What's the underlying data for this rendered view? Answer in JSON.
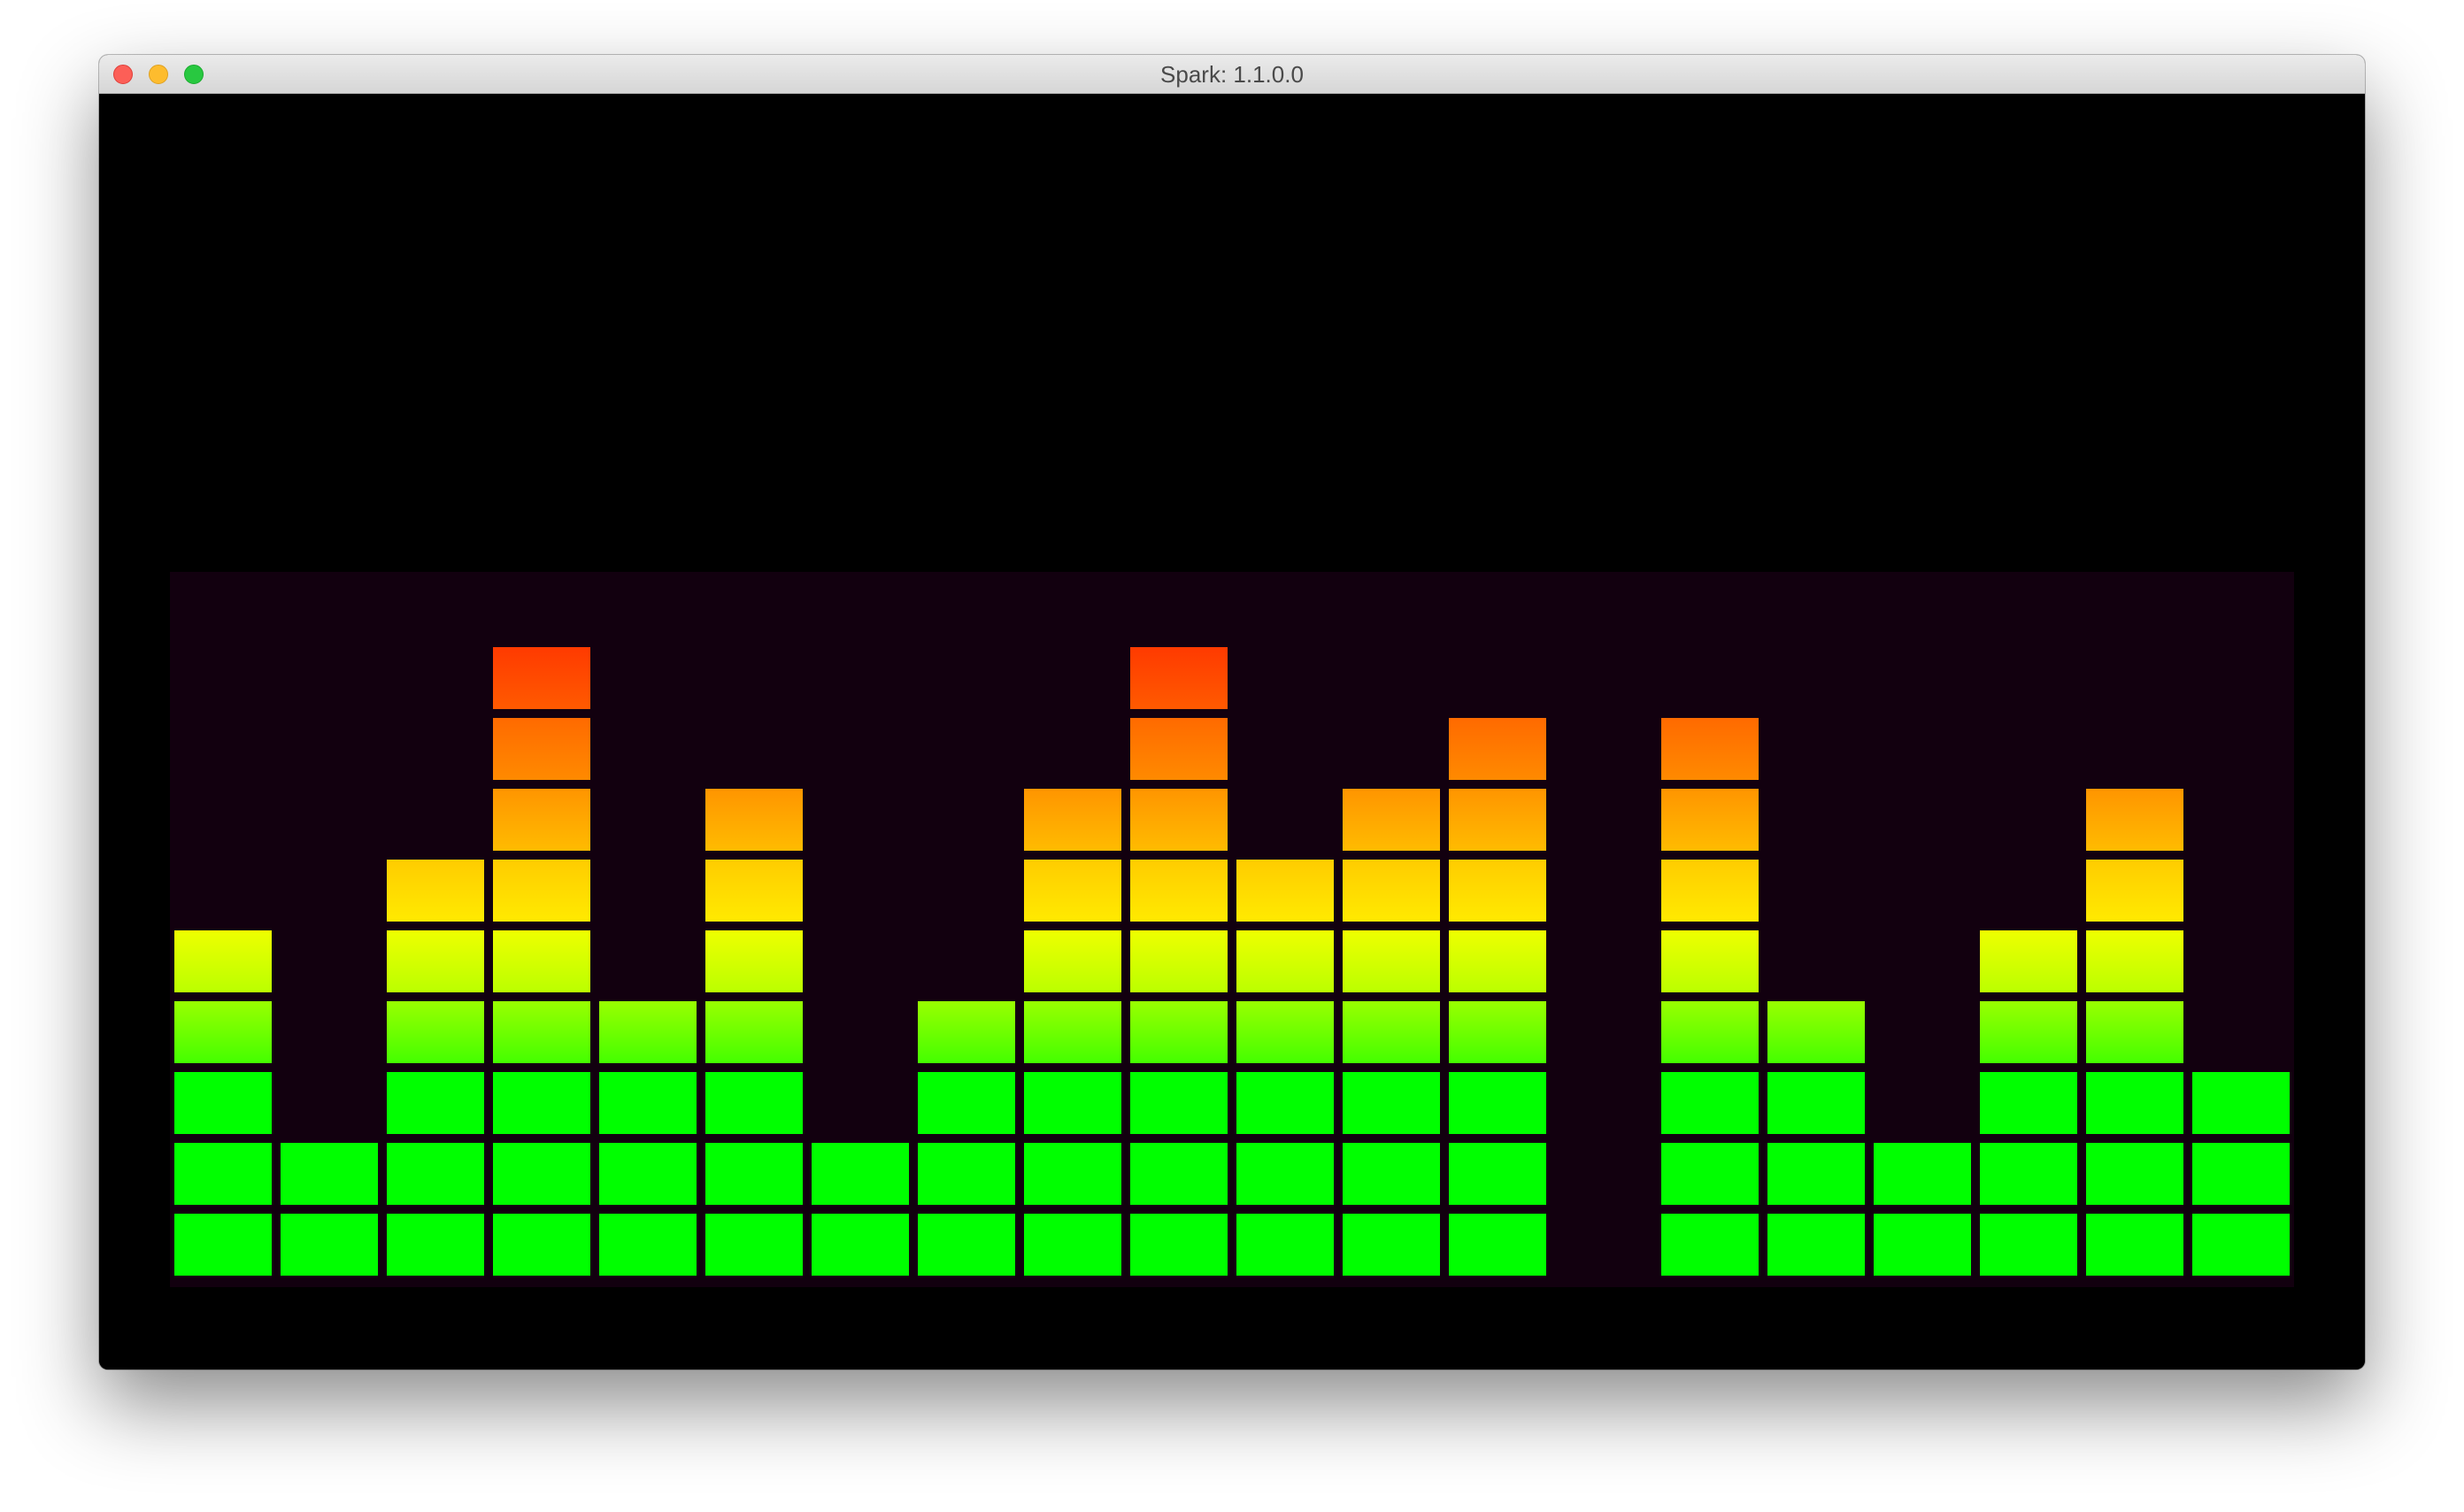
{
  "window": {
    "title": "Spark: 1.1.0.0"
  },
  "visualizer": {
    "max_segments": 9,
    "segment_colors": [
      [
        "#00ff00",
        "#00ff00"
      ],
      [
        "#00ff00",
        "#00ff00"
      ],
      [
        "#00ff00",
        "#00ff00"
      ],
      [
        "#44ff00",
        "#99ff00"
      ],
      [
        "#bbff00",
        "#eeff00"
      ],
      [
        "#ffea00",
        "#ffcc00"
      ],
      [
        "#ffbb00",
        "#ff9500"
      ],
      [
        "#ff8a00",
        "#ff6a00"
      ],
      [
        "#ff5a00",
        "#ff3a00"
      ]
    ],
    "background_color": "#12000f",
    "bars": [
      5,
      2,
      6,
      9,
      4,
      7,
      2,
      4,
      7,
      9,
      6,
      7,
      8,
      0,
      8,
      4,
      2,
      5,
      7,
      3
    ]
  }
}
